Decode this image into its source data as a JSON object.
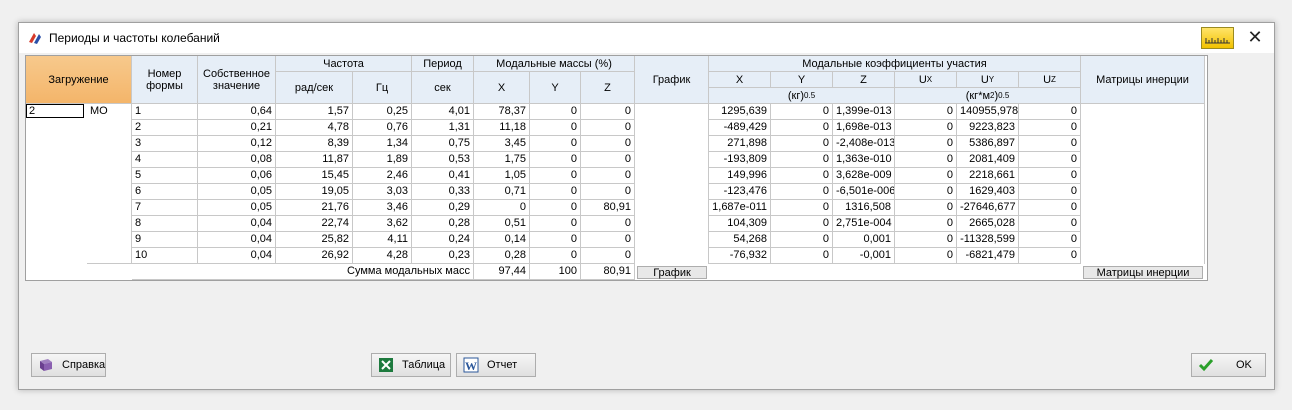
{
  "window": {
    "title": "Периоды и частоты колебаний"
  },
  "headers": {
    "loading": "Загружение",
    "mode_number_1": "Номер",
    "mode_number_2": "формы",
    "eigen_1": "Собственное",
    "eigen_2": "значение",
    "frequency": "Частота",
    "rad_s": "рад/сек",
    "hz": "Гц",
    "period": "Период",
    "sec": "сек",
    "modal_mass": "Модальные массы (%)",
    "x": "X",
    "y": "Y",
    "z": "Z",
    "graph": "График",
    "coef": "Модальные коэффициенты участия",
    "ux": "U",
    "uy": "U",
    "uz": "U",
    "sub_x": "X",
    "sub_y": "Y",
    "sub_z": "Z",
    "unit1": "(кг)",
    "unit1_sup": "0.5",
    "unit2": "(кг*м",
    "unit2_sup": "2",
    "unit2_end": ")",
    "unit2_sup2": "0.5",
    "inertia": "Матрицы инерции"
  },
  "loading": {
    "id": "2",
    "name": "МО"
  },
  "rows": [
    {
      "n": "1",
      "e": "0,64",
      "rad": "1,57",
      "hz": "0,25",
      "t": "4,01",
      "mx": "78,37",
      "my": "0",
      "mz": "0",
      "kx": "1295,639",
      "ky": "0",
      "kz": "1,399e-013",
      "ux": "0",
      "uy": "140955,978",
      "uz": "0"
    },
    {
      "n": "2",
      "e": "0,21",
      "rad": "4,78",
      "hz": "0,76",
      "t": "1,31",
      "mx": "11,18",
      "my": "0",
      "mz": "0",
      "kx": "-489,429",
      "ky": "0",
      "kz": "1,698e-013",
      "ux": "0",
      "uy": "9223,823",
      "uz": "0"
    },
    {
      "n": "3",
      "e": "0,12",
      "rad": "8,39",
      "hz": "1,34",
      "t": "0,75",
      "mx": "3,45",
      "my": "0",
      "mz": "0",
      "kx": "271,898",
      "ky": "0",
      "kz": "-2,408e-013",
      "ux": "0",
      "uy": "5386,897",
      "uz": "0"
    },
    {
      "n": "4",
      "e": "0,08",
      "rad": "11,87",
      "hz": "1,89",
      "t": "0,53",
      "mx": "1,75",
      "my": "0",
      "mz": "0",
      "kx": "-193,809",
      "ky": "0",
      "kz": "1,363e-010",
      "ux": "0",
      "uy": "2081,409",
      "uz": "0"
    },
    {
      "n": "5",
      "e": "0,06",
      "rad": "15,45",
      "hz": "2,46",
      "t": "0,41",
      "mx": "1,05",
      "my": "0",
      "mz": "0",
      "kx": "149,996",
      "ky": "0",
      "kz": "3,628e-009",
      "ux": "0",
      "uy": "2218,661",
      "uz": "0"
    },
    {
      "n": "6",
      "e": "0,05",
      "rad": "19,05",
      "hz": "3,03",
      "t": "0,33",
      "mx": "0,71",
      "my": "0",
      "mz": "0",
      "kx": "-123,476",
      "ky": "0",
      "kz": "-6,501e-006",
      "ux": "0",
      "uy": "1629,403",
      "uz": "0"
    },
    {
      "n": "7",
      "e": "0,05",
      "rad": "21,76",
      "hz": "3,46",
      "t": "0,29",
      "mx": "0",
      "my": "0",
      "mz": "80,91",
      "kx": "1,687e-011",
      "ky": "0",
      "kz": "1316,508",
      "ux": "0",
      "uy": "-27646,677",
      "uz": "0"
    },
    {
      "n": "8",
      "e": "0,04",
      "rad": "22,74",
      "hz": "3,62",
      "t": "0,28",
      "mx": "0,51",
      "my": "0",
      "mz": "0",
      "kx": "104,309",
      "ky": "0",
      "kz": "2,751e-004",
      "ux": "0",
      "uy": "2665,028",
      "uz": "0"
    },
    {
      "n": "9",
      "e": "0,04",
      "rad": "25,82",
      "hz": "4,11",
      "t": "0,24",
      "mx": "0,14",
      "my": "0",
      "mz": "0",
      "kx": "54,268",
      "ky": "0",
      "kz": "0,001",
      "ux": "0",
      "uy": "-11328,599",
      "uz": "0"
    },
    {
      "n": "10",
      "e": "0,04",
      "rad": "26,92",
      "hz": "4,28",
      "t": "0,23",
      "mx": "0,28",
      "my": "0",
      "mz": "0",
      "kx": "-76,932",
      "ky": "0",
      "kz": "-0,001",
      "ux": "0",
      "uy": "-6821,479",
      "uz": "0"
    }
  ],
  "sum": {
    "label": "Сумма модальных масс",
    "x": "97,44",
    "y": "100",
    "z": "80,91"
  },
  "buttons": {
    "graph": "График",
    "inertia": "Матрицы инерции",
    "help": "Справка",
    "table": "Таблица",
    "report": "Отчет",
    "ok": "OK"
  },
  "colors": {
    "header": "#e6eef7",
    "selected_header": "#f4b56a"
  }
}
